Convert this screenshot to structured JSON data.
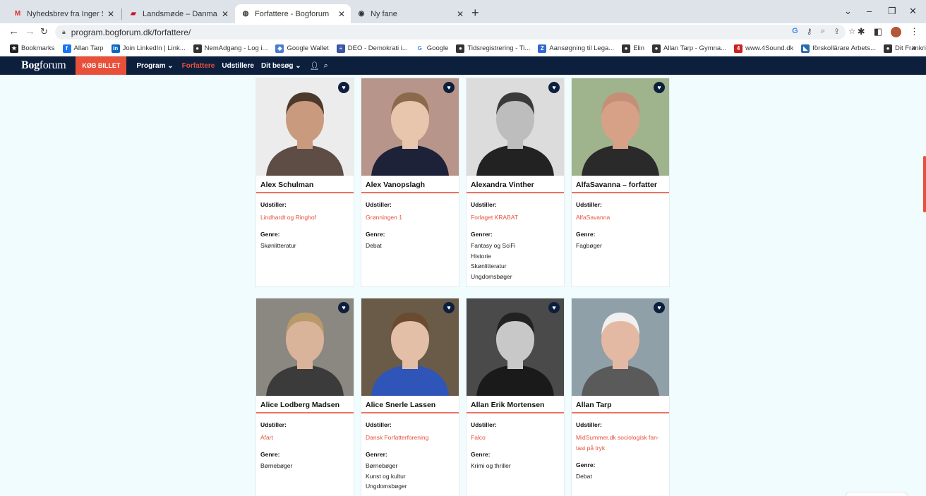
{
  "browser": {
    "tabs": [
      {
        "title": "Nyhedsbrev fra Inger Støjberg -",
        "icon": "gmail-icon",
        "active": false
      },
      {
        "title": "Landsmøde – Danmarksdemokr",
        "icon": "dd-icon",
        "active": false
      },
      {
        "title": "Forfattere - Bogforum",
        "icon": "globe-icon",
        "active": true
      },
      {
        "title": "Ny fane",
        "icon": "chrome-icon",
        "active": false
      }
    ],
    "new_tab": "+",
    "window_controls": {
      "dropdown": "⌄",
      "minimize": "–",
      "restore": "❐",
      "close": "✕"
    },
    "url": "program.bogforum.dk/forfattere/",
    "bookmarks": [
      {
        "label": "Bookmarks",
        "color": "#222222",
        "glyph": "★"
      },
      {
        "label": "Allan Tarp",
        "color": "#1877f2",
        "glyph": "f"
      },
      {
        "label": "Join LinkedIn | Link...",
        "color": "#0a66c2",
        "glyph": "in"
      },
      {
        "label": "NemAdgang - Log i...",
        "color": "#333333",
        "glyph": "●"
      },
      {
        "label": "Google Wallet",
        "color": "#4a7bd0",
        "glyph": "◆"
      },
      {
        "label": "DEO - Demokrati i...",
        "color": "#3a55a4",
        "glyph": "≡"
      },
      {
        "label": "Google",
        "color": "#ffffff",
        "glyph": "G"
      },
      {
        "label": "Tidsregistrering - Ti...",
        "color": "#333333",
        "glyph": "●"
      },
      {
        "label": "Aansøgning til Lega...",
        "color": "#3367d6",
        "glyph": "Z"
      },
      {
        "label": "Elin",
        "color": "#333333",
        "glyph": "●"
      },
      {
        "label": "Allan Tarp - Gymna...",
        "color": "#333333",
        "glyph": "●"
      },
      {
        "label": "www.4Sound.dk",
        "color": "#cc2222",
        "glyph": "4"
      },
      {
        "label": "förskollärare Arbets...",
        "color": "#2b6cb0",
        "glyph": "◣"
      },
      {
        "label": "Dit Frankrig - Udnyt...",
        "color": "#333333",
        "glyph": "●"
      }
    ],
    "bookmarks_more": "»"
  },
  "site": {
    "logo_bold": "Bog",
    "logo_light": "forum",
    "buy_label": "KØB BILLET",
    "nav": [
      {
        "label": "Program ⌄",
        "active": false
      },
      {
        "label": "Forfattere",
        "active": true
      },
      {
        "label": "Udstillere",
        "active": false
      },
      {
        "label": "Dit besøg ⌄",
        "active": false
      }
    ]
  },
  "labels": {
    "exhibitor": "Udstiller:",
    "genre_single": "Genre:",
    "genre_plural": "Genrer:"
  },
  "authors": [
    {
      "name": "Alex Schulman",
      "exhibitor": "Lindhardt og Ringhof",
      "genre_label": "Genre:",
      "genres": [
        "Skønlitteratur"
      ],
      "photo": {
        "bg": "#ececec",
        "skin": "#c99a7e",
        "hair": "#4b3a2c",
        "cloth": "#5d4d45"
      }
    },
    {
      "name": "Alex Vanopslagh",
      "exhibitor": "Grønningen 1",
      "genre_label": "Genre:",
      "genres": [
        "Debat"
      ],
      "photo": {
        "bg": "#b8958a",
        "skin": "#e7c6ad",
        "hair": "#8a6a4a",
        "cloth": "#1d2238"
      }
    },
    {
      "name": "Alexandra Vinther",
      "exhibitor": "Forlaget KRABAT",
      "genre_label": "Genrer:",
      "genres": [
        "Fantasy og SciFi",
        "Historie",
        "Skønlitteratur",
        "Ungdomsbøger"
      ],
      "photo": {
        "bg": "#dcdcdc",
        "skin": "#bdbdbd",
        "hair": "#3a3a3a",
        "cloth": "#222222"
      }
    },
    {
      "name": "AlfaSavanna – forfatter",
      "exhibitor": "AlfaSavanna",
      "genre_label": "Genre:",
      "genres": [
        "Fagbøger"
      ],
      "photo": {
        "bg": "#9fb48d",
        "skin": "#d7a188",
        "hair": "#c58e77",
        "cloth": "#2a2a2a"
      }
    },
    {
      "name": "Alice Lodberg Madsen",
      "exhibitor": "Afart",
      "genre_label": "Genre:",
      "genres": [
        "Børnebøger"
      ],
      "photo": {
        "bg": "#8a8880",
        "skin": "#d9b39a",
        "hair": "#b89a6a",
        "cloth": "#3b3b3b"
      }
    },
    {
      "name": "Alice Snerle Lassen",
      "exhibitor": "Dansk Forfatterforening",
      "genre_label": "Genrer:",
      "genres": [
        "Børnebøger",
        "Kunst og kultur",
        "Ungdomsbøger"
      ],
      "photo": {
        "bg": "#6a5a48",
        "skin": "#e2bfa6",
        "hair": "#6b4b2f",
        "cloth": "#2f55b8"
      }
    },
    {
      "name": "Allan Erik Mortensen",
      "exhibitor": "Falco",
      "genre_label": "Genre:",
      "genres": [
        "Krimi og thriller"
      ],
      "photo": {
        "bg": "#4a4a4a",
        "skin": "#c8c8c8",
        "hair": "#222222",
        "cloth": "#1a1a1a"
      }
    },
    {
      "name": "Allan Tarp",
      "exhibitor": "MidSummer.dk sociologisk fan-tasi på tryk",
      "genre_label": "Genre:",
      "genres": [
        "Debat"
      ],
      "photo": {
        "bg": "#8fa0a8",
        "skin": "#e4b9a4",
        "hair": "#f0f0f0",
        "cloth": "#5a5a5a"
      }
    }
  ]
}
